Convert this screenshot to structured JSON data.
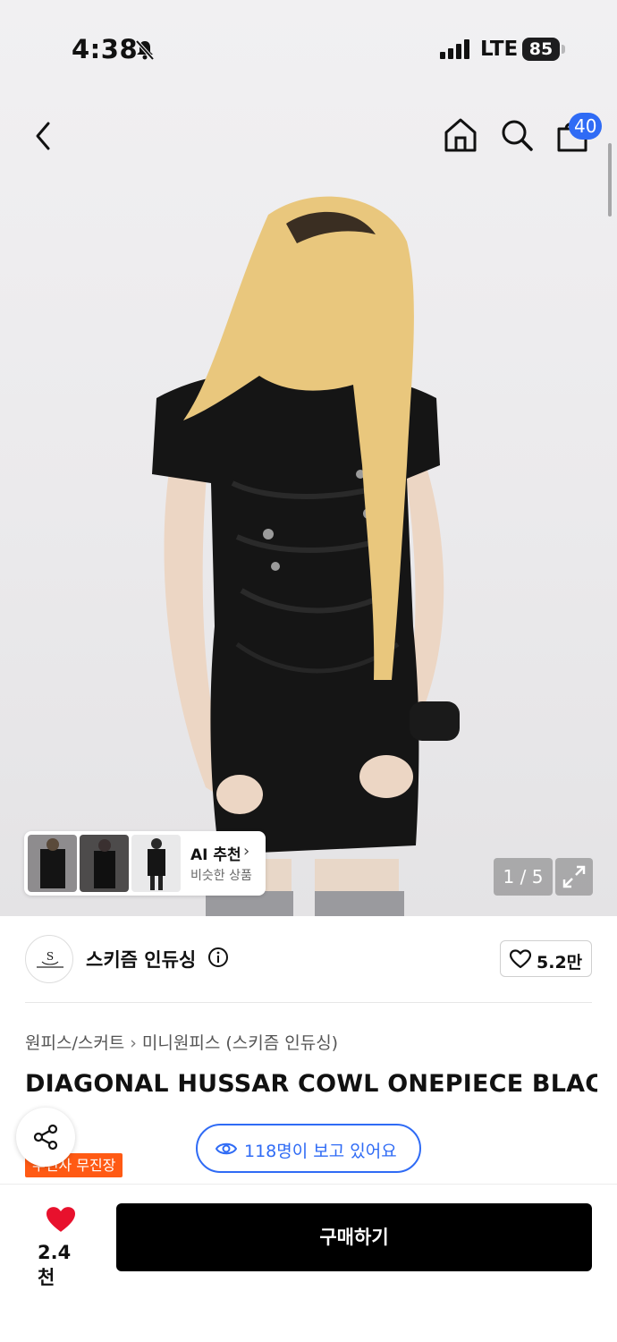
{
  "status_bar": {
    "time": "4:38",
    "network": "LTE",
    "battery": "85"
  },
  "nav": {
    "cart_count": "40"
  },
  "gallery": {
    "page_indicator": "1 / 5",
    "ai_recommend": {
      "title": "AI 추천",
      "subtitle": "비슷한 상품"
    }
  },
  "brand": {
    "name": "스키즘 인듀싱",
    "like_count": "5.2만"
  },
  "breadcrumb": {
    "category": "원피스/스커트",
    "subcategory": "미니원피스 (스키즘 인듀싱)"
  },
  "product": {
    "title": "DIAGONAL HUSSAR COWL ONEPIECE BLAC",
    "badge": "무신사 무진장",
    "viewers": "118명이 보고 있어요"
  },
  "bottom": {
    "wish_count": "2.4천",
    "buy_label": "구매하기"
  },
  "colors": {
    "accent_blue": "#2f6bf5",
    "badge_orange": "#ff5a14",
    "heart_red": "#e8112d",
    "buy_button": "#000000"
  },
  "icons": [
    "back-icon",
    "home-icon",
    "search-icon",
    "cart-icon",
    "expand-icon",
    "info-icon",
    "heart-outline-icon",
    "share-icon",
    "eye-icon",
    "heart-filled-icon",
    "bell-slash-icon",
    "signal-icon"
  ]
}
